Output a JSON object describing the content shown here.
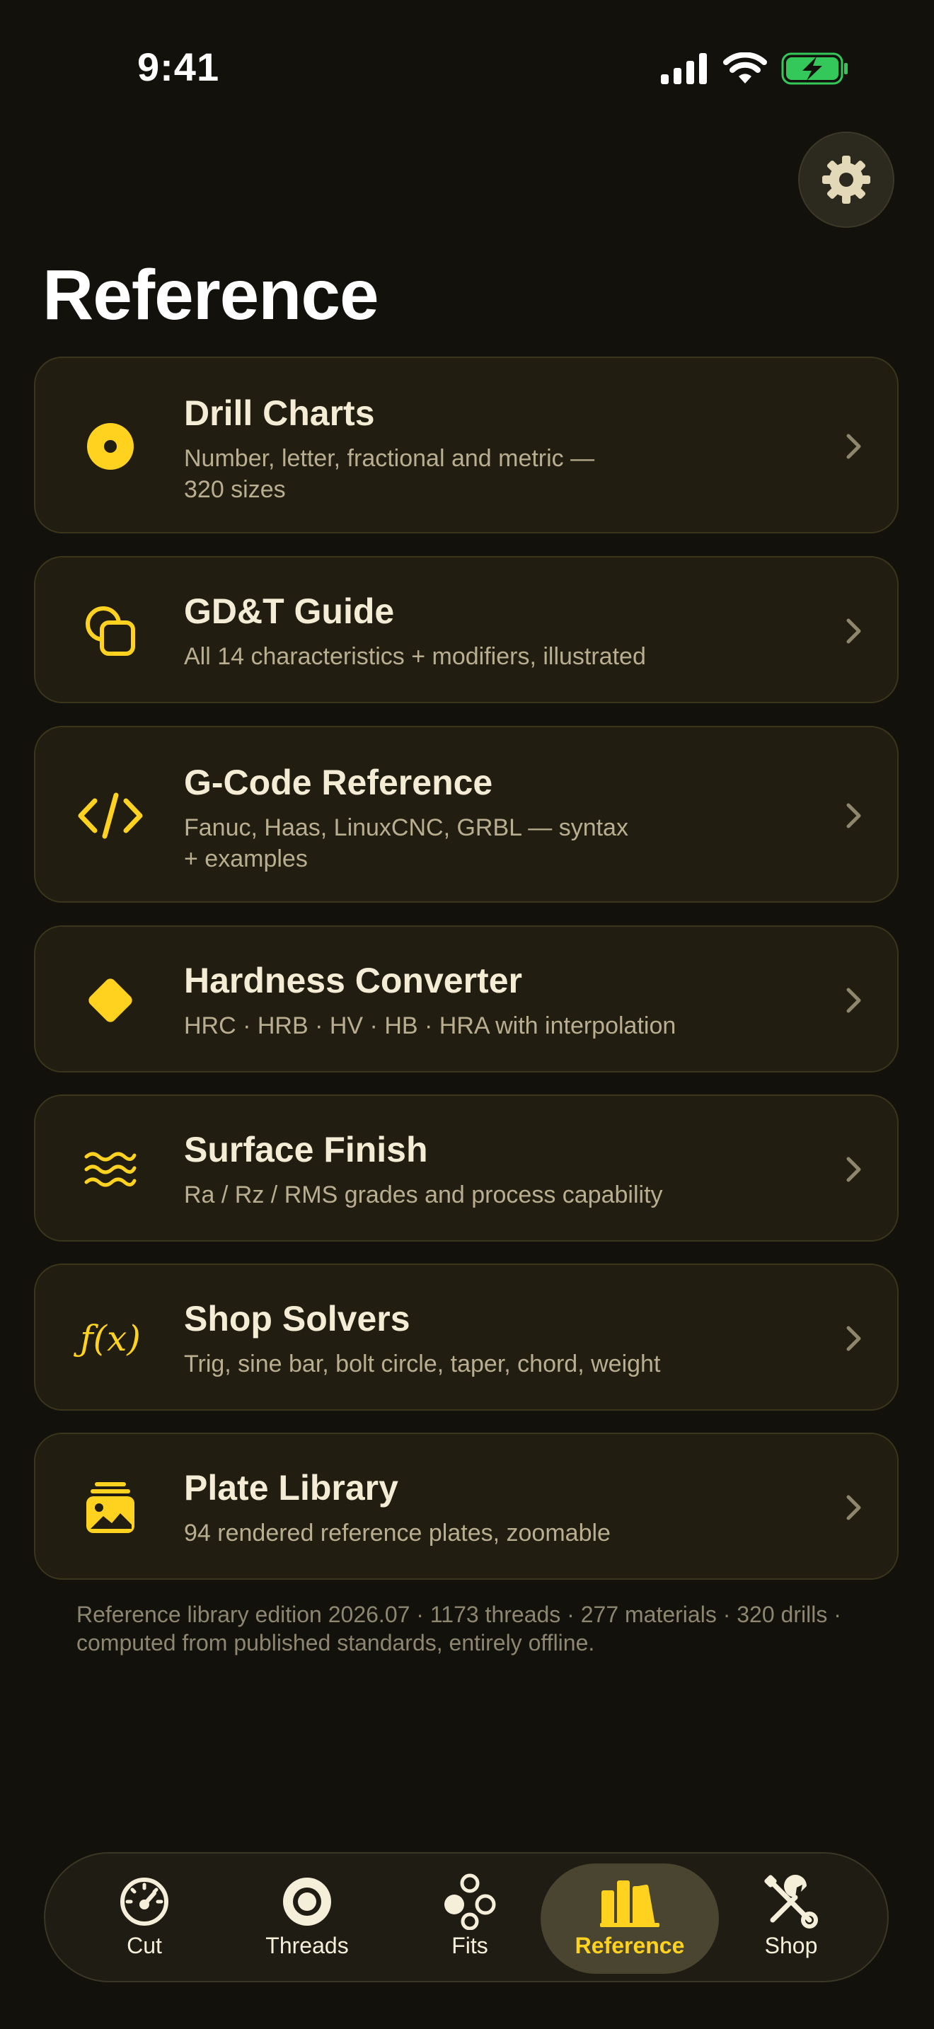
{
  "status": {
    "time": "9:41"
  },
  "header": {
    "title": "Reference"
  },
  "cards": [
    {
      "title": "Drill Charts",
      "subtitle_line1": "Number, letter, fractional and metric —",
      "subtitle_line2": "320 sizes",
      "icon": "drill-target-icon"
    },
    {
      "title": "GD&T Guide",
      "subtitle": "All 14 characteristics + modifiers, illustrated",
      "icon": "gdt-shapes-icon"
    },
    {
      "title": "G-Code Reference",
      "subtitle_line1": "Fanuc, Haas, LinuxCNC, GRBL — syntax",
      "subtitle_line2": "+ examples",
      "icon": "code-brackets-icon"
    },
    {
      "title": "Hardness Converter",
      "subtitle": "HRC · HRB · HV · HB · HRA with interpolation",
      "icon": "diamond-icon"
    },
    {
      "title": "Surface Finish",
      "subtitle": "Ra / Rz / RMS grades and process capability",
      "icon": "waves-icon"
    },
    {
      "title": "Shop Solvers",
      "subtitle": "Trig, sine bar, bolt circle, taper, chord, weight",
      "icon": "function-icon",
      "icon_text": "ƒ(x)"
    },
    {
      "title": "Plate Library",
      "subtitle": "94 rendered reference plates, zoomable",
      "icon": "photo-stack-icon"
    }
  ],
  "footnote": "Reference library edition 2026.07 · 1173 threads · 277 materials · 320 drills · computed from published standards, entirely offline.",
  "tabs": [
    {
      "label": "Cut",
      "icon": "gauge-icon",
      "active": false
    },
    {
      "label": "Threads",
      "icon": "ring-icon",
      "active": false
    },
    {
      "label": "Fits",
      "icon": "circles-icon",
      "active": false
    },
    {
      "label": "Reference",
      "icon": "books-icon",
      "active": true
    },
    {
      "label": "Shop",
      "icon": "tools-icon",
      "active": false
    }
  ],
  "colors": {
    "accent": "#ffd21f",
    "background": "#13110b",
    "card": "#211d11",
    "battery": "#34c759"
  }
}
